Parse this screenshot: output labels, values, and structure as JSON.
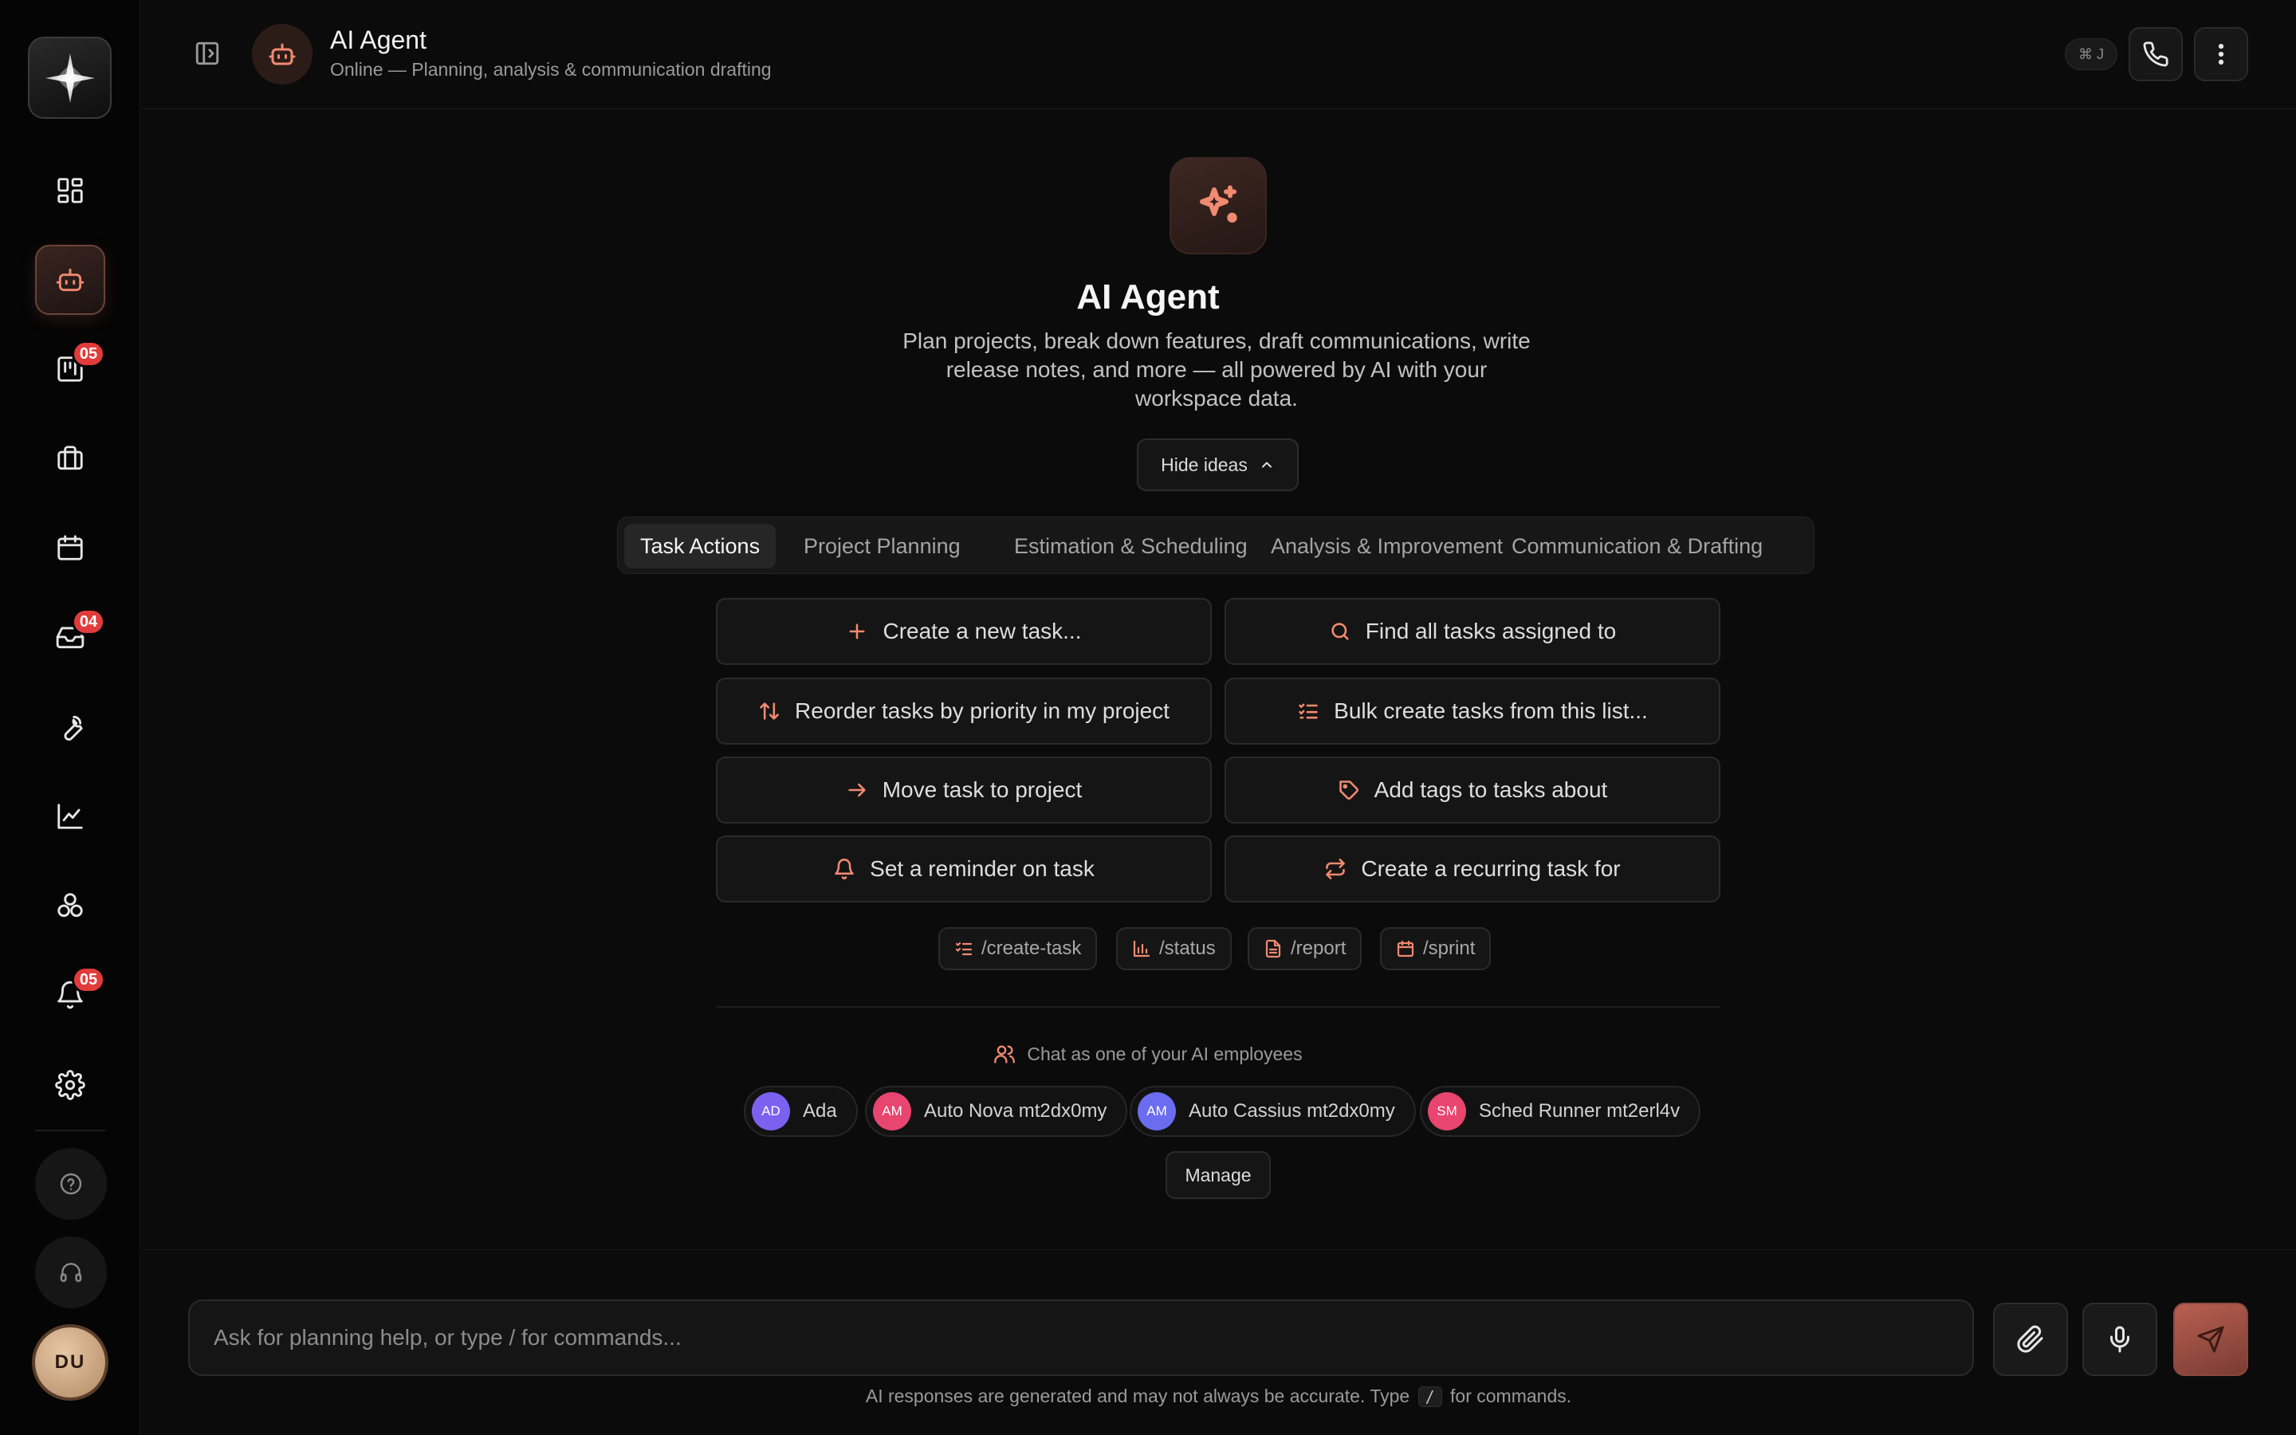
{
  "header": {
    "title": "AI Agent",
    "subtitle": "Online — Planning, analysis & communication drafting",
    "shortcut": "⌘ J"
  },
  "sidebar": {
    "items": [
      {
        "name": "dashboard",
        "icon": "dashboard-icon"
      },
      {
        "name": "ai-agent",
        "icon": "bot-icon",
        "active": true
      },
      {
        "name": "board",
        "icon": "kanban-icon",
        "badge": "05"
      },
      {
        "name": "projects",
        "icon": "briefcase-icon"
      },
      {
        "name": "calendar",
        "icon": "calendar-icon"
      },
      {
        "name": "inbox",
        "icon": "inbox-icon",
        "badge": "04"
      },
      {
        "name": "tools",
        "icon": "wrench-icon"
      },
      {
        "name": "analytics",
        "icon": "line-chart-icon"
      },
      {
        "name": "integrations",
        "icon": "modules-icon"
      },
      {
        "name": "notifications",
        "icon": "bell-icon",
        "badge": "05"
      },
      {
        "name": "settings",
        "icon": "gear-icon"
      }
    ],
    "user_initials": "DU"
  },
  "hero": {
    "title": "AI Agent",
    "description": "Plan projects, break down features, draft communications, write release notes, and more — all powered by AI with your workspace data.",
    "toggle_label": "Hide ideas"
  },
  "tabs": [
    "Task Actions",
    "Project Planning",
    "Estimation & Scheduling",
    "Analysis & Improvement",
    "Communication & Drafting"
  ],
  "actions": [
    {
      "label": "Create a new task...",
      "icon": "plus-icon"
    },
    {
      "label": "Find all tasks assigned to",
      "icon": "search-icon"
    },
    {
      "label": "Reorder tasks by priority in my project",
      "icon": "sort-arrows-icon"
    },
    {
      "label": "Bulk create tasks from this list...",
      "icon": "list-checks-icon"
    },
    {
      "label": "Move task to project",
      "icon": "arrow-right-icon"
    },
    {
      "label": "Add tags to tasks about",
      "icon": "tag-icon"
    },
    {
      "label": "Set a reminder on task",
      "icon": "bell-icon"
    },
    {
      "label": "Create a recurring task for",
      "icon": "repeat-icon"
    }
  ],
  "commands": [
    "/create-task",
    "/status",
    "/report",
    "/sprint"
  ],
  "employees": {
    "label": "Chat as one of your AI employees",
    "list": [
      {
        "initials": "AD",
        "name": "Ada",
        "color": "#7b61f0"
      },
      {
        "initials": "AM",
        "name": "Auto Nova mt2dx0my",
        "color": "#e8456f"
      },
      {
        "initials": "AM",
        "name": "Auto Cassius mt2dx0my",
        "color": "#6c6cf0"
      },
      {
        "initials": "SM",
        "name": "Sched Runner mt2erl4v",
        "color": "#e8456f"
      }
    ],
    "manage_label": "Manage"
  },
  "composer": {
    "placeholder": "Ask for planning help, or type / for commands...",
    "disclaimer_before": "AI responses are generated and may not always be accurate. Type",
    "disclaimer_key": "/",
    "disclaimer_after": "for commands."
  },
  "colors": {
    "accent": "#f08a70",
    "badge": "#e23b3b",
    "background": "#0b0b0b"
  }
}
